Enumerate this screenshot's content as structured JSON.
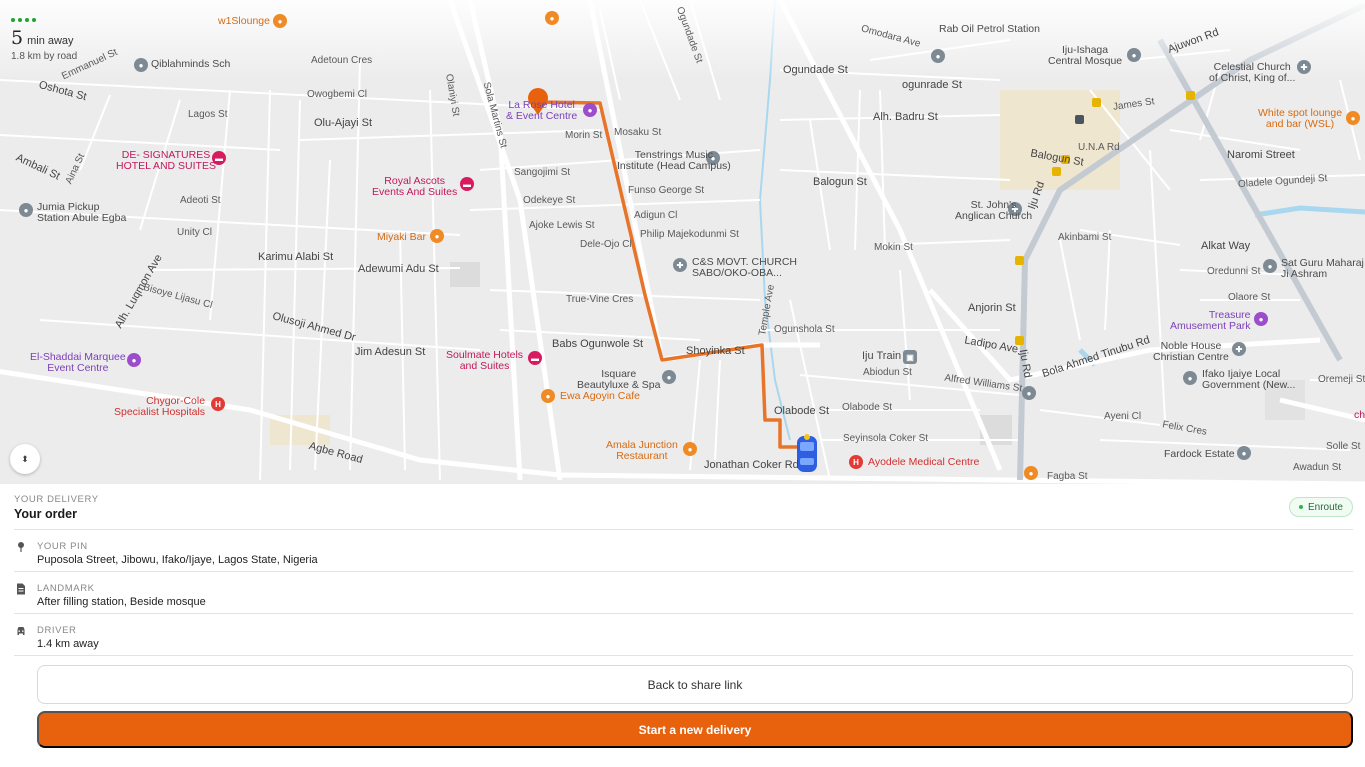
{
  "eta": {
    "minutes": "5",
    "unit": "min away",
    "distance": "1.8 km by road"
  },
  "map": {
    "labels": {
      "top_lounge": "w1Slounge",
      "adetoun": "Adetoun Cres",
      "owogbemi": "Owogbemi Cl",
      "qiblahminds": "Qiblahminds Sch",
      "emmanuel": "Emmanuel St",
      "oshota": "Oshota St",
      "lagos_st": "Lagos St",
      "olu_ajayi": "Olu-Ajayi St",
      "de_signatures": "DE- SIGNATURES\nHOTEL AND SUITES",
      "ambali": "Ambali St",
      "aina": "Aina St",
      "jumia": "Jumia Pickup\nStation Abule Egba",
      "adeoti": "Adeoti St",
      "unity": "Unity Cl",
      "karimu": "Karimu Alabi St",
      "adewumi": "Adewumi Adu St",
      "luqmon": "Alh. Luqmon Ave",
      "bisoye": "Bisoye Lijasu Cl",
      "olusoji": "Olusoji Ahmed Dr",
      "jim_adesun": "Jim Adesun St",
      "el_shaddai": "El-Shaddai Marquee\nEvent Centre",
      "chygor": "Chygor-Cole\nSpecialist Hospitals",
      "agbe": "Agbe Road",
      "royal_ascots": "Royal Ascots\nEvents And Suites",
      "miyaki": "Miyaki Bar",
      "olaniyi_top": "Olaniyi St",
      "sola_martins": "Sola Martins St",
      "la_rose": "La Rose Hotel\n& Event Centre",
      "morin": "Morin St",
      "mosaku": "Mosaku St",
      "sangojimi": "Sangojimi St",
      "odekeye": "Odekeye St",
      "ajoke": "Ajoke Lewis St",
      "dele_ojo": "Dele-Ojo Cl",
      "true_vine": "True-Vine Cres",
      "babs": "Babs Ogunwole St",
      "soulmate": "Soulmate Hotels\nand Suites",
      "tenstrings": "Tenstrings Music\nInstitute (Head Campus)",
      "funso": "Funso George St",
      "adigun": "Adigun Cl",
      "philip": "Philip Majekodunmi St",
      "cs_movt": "C&S MOVT. CHURCH\nSABO/OKO-OBA...",
      "shoyinka": "Shoyinka St",
      "isquare": "Isquare\nBeautyluxe & Spa",
      "ewa": "Ewa Agoyin Cafe",
      "amala": "Amala Junction\nRestaurant",
      "jonathan": "Jonathan Coker Rd",
      "ayodele": "Ayodele Medical Centre",
      "temple": "Temple Ave",
      "ogunshola": "Ogunshola St",
      "olabode": "Olabode St",
      "seyinsola": "Seyinsola Coker St",
      "iju_train": "Iju Train",
      "abiodun": "Abiodun St",
      "alfred": "Alfred Williams St",
      "ogundade": "Ogundade St",
      "ogunrade": "ogunrade St",
      "badru": "Alh. Badru St",
      "balogun": "Balogun St",
      "balogun2": "Balogun St",
      "mokin": "Mokin St",
      "rab_oil": "Rab Oil Petrol Station",
      "omodara": "Omodara Ave",
      "iju_ishaga": "Iju-Ishaga\nCentral Mosque",
      "celestial": "Celestial Church\nof Christ, King of...",
      "ajuwon": "Ajuwon Rd",
      "james": "James St",
      "una": "U.N.A Rd",
      "naromi": "Naromi Street",
      "white_spot": "White spot lounge\nand bar (WSL)",
      "oladele": "Oladele Ogundeji St",
      "st_johns": "St. John's\nAnglican Church",
      "iju_rd": "Iju Rd",
      "iju_rd2": "Iju Rd",
      "akinbami": "Akinbami St",
      "alkat": "Alkat Way",
      "oredunni": "Oredunni St",
      "sat_guru": "Sat Guru Maharaj\nJi Ashram",
      "anjorin": "Anjorin St",
      "olaore": "Olaore St",
      "treasure": "Treasure\nAmusement Park",
      "ladipo": "Ladipo Ave",
      "bola": "Bola Ahmed Tinubu Rd",
      "noble_house": "Noble House\nChristian Centre",
      "ifako": "Ifako Ijaiye Local\nGovernment (New...",
      "oremeji": "Oremeji St",
      "ayeni": "Ayeni Cl",
      "felix": "Felix Cres",
      "fardock": "Fardock Estate",
      "solle": "Solle St",
      "awadun": "Awadun St",
      "fagba": "Fagba St",
      "ch_edge": "ch"
    }
  },
  "delivery": {
    "section_label": "YOUR DELIVERY",
    "title": "Your order",
    "status": "Enroute",
    "rows": [
      {
        "label": "YOUR PIN",
        "value": "Puposola Street, Jibowu, Ifako/Ijaye, Lagos State, Nigeria",
        "icon": "pin-icon"
      },
      {
        "label": "LANDMARK",
        "value": "After filling station, Beside mosque",
        "icon": "document-icon"
      },
      {
        "label": "DRIVER",
        "value": "1.4 km away",
        "icon": "car-icon"
      }
    ]
  },
  "buttons": {
    "share": "Back to share link",
    "new_delivery": "Start a new delivery"
  },
  "colors": {
    "accent": "#e8620e",
    "route": "#e8742a",
    "status_green": "#2fb24c",
    "driver": "#2f5fe0"
  }
}
